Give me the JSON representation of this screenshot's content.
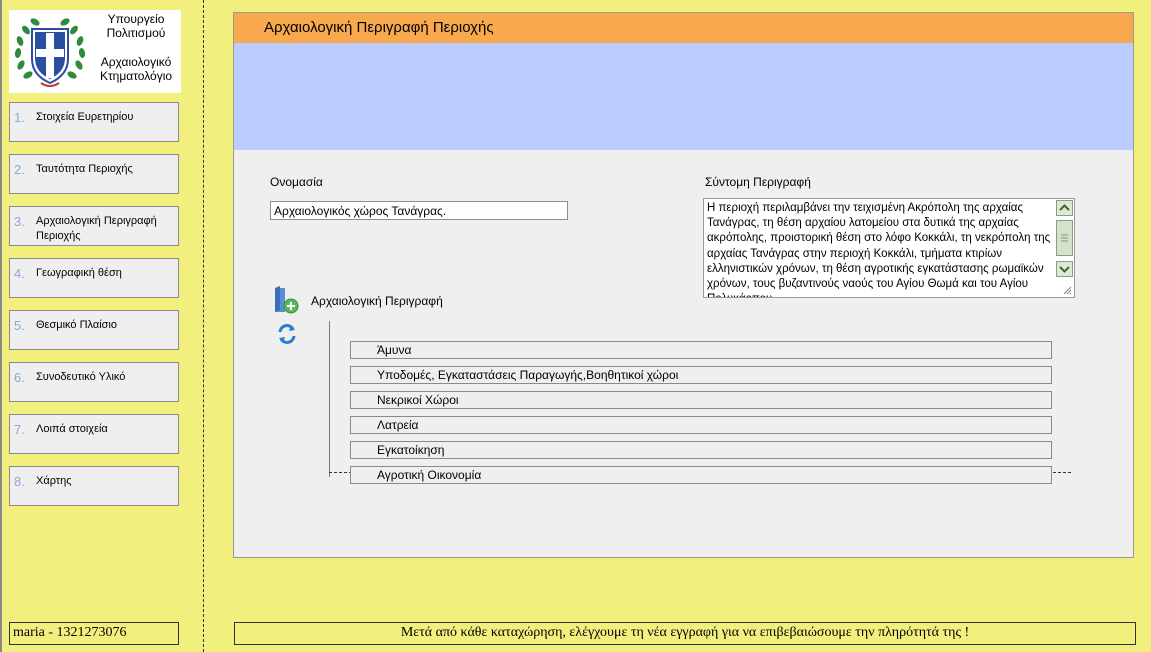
{
  "logo": {
    "ministry_line1": "Υπουργείο",
    "ministry_line2": "Πολιτισμού",
    "registry_line1": "Αρχαιολογικό",
    "registry_line2": "Κτηματολόγιο"
  },
  "sidebar": {
    "items": [
      {
        "num": "1.",
        "label": "Στοιχεία Ευρετηρίου"
      },
      {
        "num": "2.",
        "label": "Ταυτότητα Περιοχής"
      },
      {
        "num": "3.",
        "label": "Αρχαιολογική Περιγραφή Περιοχής"
      },
      {
        "num": "4.",
        "label": "Γεωγραφική θέση"
      },
      {
        "num": "5.",
        "label": "Θεσμικό Πλαίσιο"
      },
      {
        "num": "6.",
        "label": "Συνοδευτικό Υλικό"
      },
      {
        "num": "7.",
        "label": "Λοιπά στοιχεία"
      },
      {
        "num": "8.",
        "label": "Χάρτης"
      }
    ]
  },
  "panel": {
    "title": "Αρχαιολογική Περιγραφή Περιοχής",
    "name_label": "Ονομασία",
    "name_value": "Αρχαιολογικός χώρος Τανάγρας.",
    "short_desc_label": "Σύντομη Περιγραφή",
    "short_desc_value": "Η περιοχή περιλαμβάνει την τειχισμένη Ακρόπολη της αρχαίας Τανάγρας, τη θέση αρχαίου λατομείου στα δυτικά της αρχαίας ακρόπολης, προιστορική θέση στο λόφο Κοκκάλι, τη νεκρόπολη της αρχαίας Τανάγρας στην περιοχή Κοκκάλι, τμήματα κτιρίων ελληνιστικών χρόνων, τη θέση αγροτικής εγκατάστασης ρωμαϊκών χρόνων, τους βυζαντινούς ναούς του Αγίου Θωμά και του Αγίου Πολυκάρπου",
    "arch_desc_label": "Αρχαιολογική Περιγραφή",
    "categories": [
      "Άμυνα",
      "Υποδομές, Εγκαταστάσεις Παραγωγής,Βοηθητικοί χώροι",
      "Νεκρικοί Χώροι",
      "Λατρεία",
      "Εγκατοίκηση",
      "Αγροτική Οικονομία"
    ]
  },
  "status": {
    "user": "maria - 1321273076",
    "message": "Μετά από κάθε καταχώρηση, ελέγχουμε τη νέα εγγραφή για να επιβεβαιώσουμε την πληρότητά της !"
  },
  "colors": {
    "background": "#f1f07e",
    "header": "#f9a94d",
    "banner": "#bcccff",
    "panel": "#efefef"
  }
}
